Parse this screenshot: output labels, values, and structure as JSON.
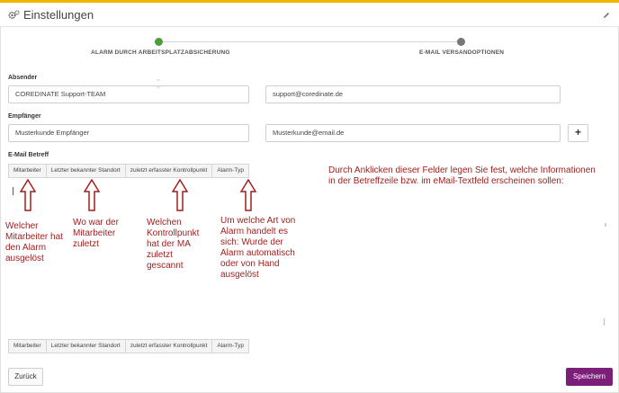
{
  "header": {
    "title": "Einstellungen",
    "title_icon": "gears-icon",
    "edit_icon": "pencil-icon"
  },
  "stepper": {
    "steps": [
      {
        "label": "ALARM DURCH ARBEITSPLATZABSICHERUNG",
        "state": "active",
        "color": "#4f9d3a"
      },
      {
        "label": "E-MAIL VERSANDOPTIONEN",
        "state": "inactive",
        "color": "#777777"
      }
    ]
  },
  "sender": {
    "label": "Absender",
    "name": "COREDINATE Support-TEAM",
    "email": "support@coredinate.de"
  },
  "recipient": {
    "label": "Empfänger",
    "name": "Musterkunde Empfänger",
    "email": "Musterkunde@email.de",
    "add_label": "+"
  },
  "subject": {
    "label": "E-Mail Betreff",
    "chips": [
      "Mitarbeiter",
      "Letzter bekannter Standort",
      "zuletzt erfasster Kontrollpunkt",
      "Alarm-Typ"
    ]
  },
  "body_chips": [
    "Mitarbeiter",
    "Letzter bekannter Standort",
    "zuletzt erfasster Kontrollpunkt",
    "Alarm-Typ"
  ],
  "annotations": {
    "intro": "Durch Anklicken dieser Felder legen Sie fest, welche Informationen in der Betreffzeile bzw. im eMail-Textfeld erscheinen sollen:",
    "mitarbeiter": "Welcher Mitarbeiter hat den Alarm ausgelöst",
    "standort": "Wo war der Mitarbeiter zuletzt",
    "kontrollpunkt": "Welchen Kontrollpunkt hat der MA zuletzt gescannt",
    "alarmtyp": "Um welche Art von Alarm handelt es sich: Wurde der Alarm automatisch oder von Hand ausgelöst",
    "color": "#a01f1f"
  },
  "footer": {
    "back_label": "Zurück",
    "save_label": "Speichern",
    "save_color": "#7b1f78"
  }
}
